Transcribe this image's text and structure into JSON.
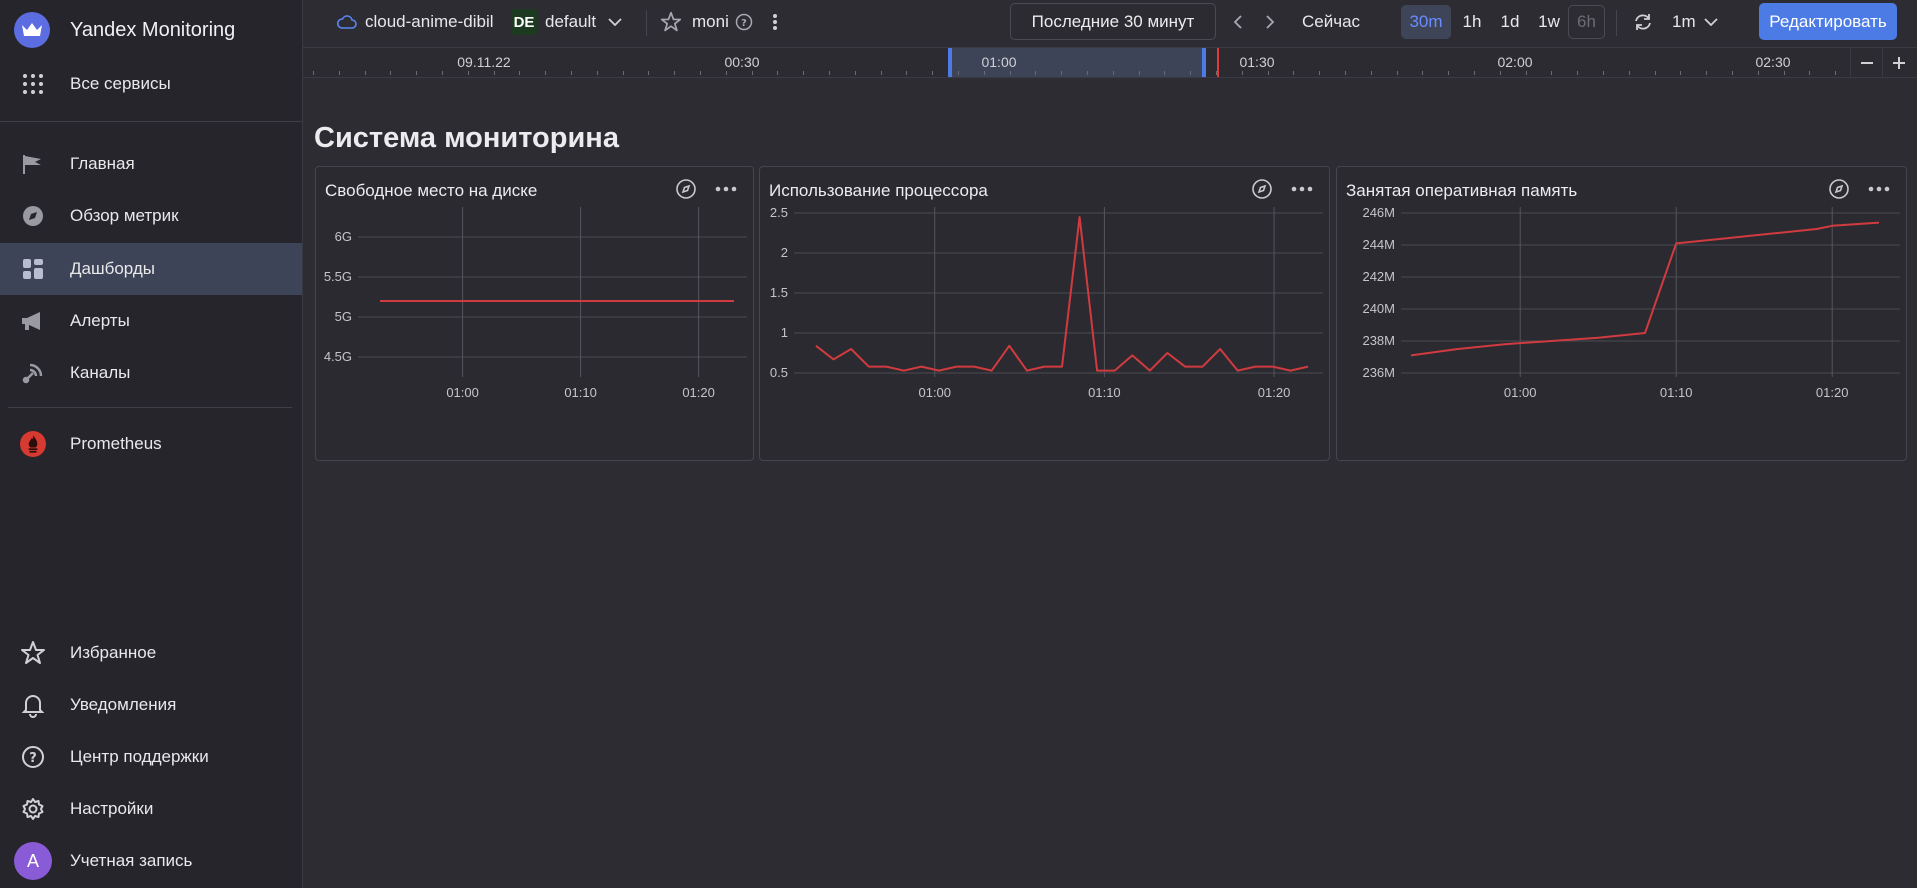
{
  "app": {
    "title": "Yandex Monitoring",
    "all_services": "Все сервисы"
  },
  "sidebar": {
    "nav": [
      {
        "label": "Главная",
        "icon": "flag-icon"
      },
      {
        "label": "Обзор метрик",
        "icon": "compass-icon"
      },
      {
        "label": "Дашборды",
        "icon": "dashboard-grid-icon"
      },
      {
        "label": "Алерты",
        "icon": "megaphone-icon"
      },
      {
        "label": "Каналы",
        "icon": "broadcast-icon"
      }
    ],
    "prometheus": "Prometheus",
    "bottom": [
      {
        "label": "Избранное",
        "icon": "star-icon"
      },
      {
        "label": "Уведомления",
        "icon": "bell-icon"
      },
      {
        "label": "Центр поддержки",
        "icon": "help-icon"
      },
      {
        "label": "Настройки",
        "icon": "gear-icon"
      },
      {
        "label": "Учетная запись",
        "icon": "avatar-icon",
        "avatar_letter": "A"
      }
    ]
  },
  "header": {
    "cloud": "cloud-anime-dibil",
    "folder_badge": "DE",
    "folder": "default",
    "dashboard": "moni",
    "time_range": "Последние 30 минут",
    "now": "Сейчас",
    "periods": [
      "30m",
      "1h",
      "1d",
      "1w",
      "6h"
    ],
    "active_period": "30m",
    "refresh_interval": "1m",
    "edit": "Редактировать"
  },
  "timeline": {
    "labels": [
      "09.11.22",
      "00:30",
      "01:00",
      "01:30",
      "02:00",
      "02:30"
    ]
  },
  "dashboard": {
    "title": "Система мониторина",
    "colors": {
      "series": "#d03b3f",
      "grid": "#4a4a52",
      "accent": "#4c7be6"
    }
  },
  "chart_data": [
    {
      "type": "line",
      "title": "Свободное место на диске",
      "x": [
        "00:53",
        "01:23"
      ],
      "x_ticks": [
        "01:00",
        "01:10",
        "01:20"
      ],
      "y_ticks": [
        "4.5G",
        "5G",
        "5.5G",
        "6G"
      ],
      "series": [
        {
          "values": [
            5.2,
            5.2
          ]
        }
      ],
      "ylim": [
        4.3,
        6.3
      ],
      "grid": true
    },
    {
      "type": "line",
      "title": "Использование процессора",
      "x": [
        "00:53",
        "00:54",
        "00:55",
        "00:56",
        "00:57",
        "00:58",
        "00:59",
        "01:00",
        "01:01",
        "01:02",
        "01:03",
        "01:04",
        "01:05",
        "01:06",
        "01:07",
        "01:08",
        "01:09",
        "01:10",
        "01:11",
        "01:12",
        "01:13",
        "01:14",
        "01:15",
        "01:16",
        "01:17",
        "01:18",
        "01:19",
        "01:20",
        "01:21",
        "01:22",
        "01:23"
      ],
      "x_ticks": [
        "01:00",
        "01:10",
        "01:20"
      ],
      "y_ticks": [
        "0.5",
        "1",
        "1.5",
        "2",
        "2.5"
      ],
      "series": [
        {
          "values": [
            0.84,
            0.67,
            0.8,
            0.58,
            0.58,
            0.53,
            0.58,
            0.53,
            0.58,
            0.58,
            0.53,
            0.84,
            0.53,
            0.58,
            0.58,
            2.45,
            0.53,
            0.53,
            0.72,
            0.53,
            0.75,
            0.58,
            0.58,
            0.8,
            0.53,
            0.58,
            0.58,
            0.53,
            0.58
          ]
        }
      ],
      "ylim": [
        0.5,
        2.5
      ],
      "grid": true
    },
    {
      "type": "line",
      "title": "Занятая оперативная память",
      "x": [
        "00:53",
        "00:56",
        "00:59",
        "01:02",
        "01:05",
        "01:08",
        "01:10",
        "01:13",
        "01:16",
        "01:19",
        "01:20",
        "01:23"
      ],
      "x_ticks": [
        "01:00",
        "01:10",
        "01:20"
      ],
      "y_ticks": [
        "236M",
        "238M",
        "240M",
        "242M",
        "244M",
        "246M"
      ],
      "series": [
        {
          "values": [
            237.1,
            237.5,
            237.8,
            238.0,
            238.2,
            238.5,
            244.1,
            244.4,
            244.7,
            245.0,
            245.2,
            245.4
          ]
        }
      ],
      "ylim": [
        236,
        246
      ],
      "grid": true
    }
  ]
}
